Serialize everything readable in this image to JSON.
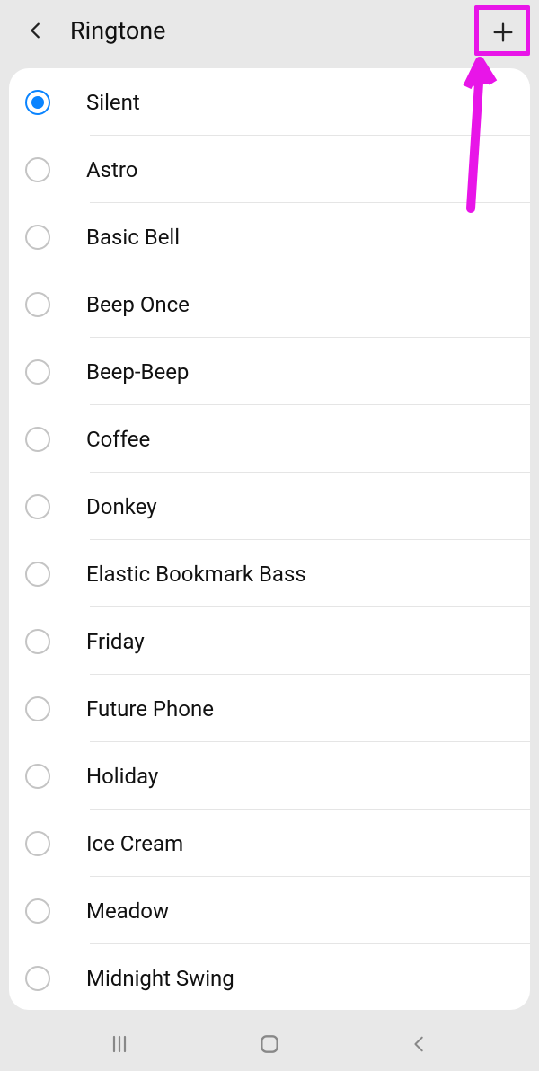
{
  "header": {
    "title": "Ringtone"
  },
  "ringtones": [
    {
      "label": "Silent",
      "selected": true
    },
    {
      "label": "Astro",
      "selected": false
    },
    {
      "label": "Basic Bell",
      "selected": false
    },
    {
      "label": "Beep Once",
      "selected": false
    },
    {
      "label": "Beep-Beep",
      "selected": false
    },
    {
      "label": "Coffee",
      "selected": false
    },
    {
      "label": "Donkey",
      "selected": false
    },
    {
      "label": "Elastic Bookmark Bass",
      "selected": false
    },
    {
      "label": "Friday",
      "selected": false
    },
    {
      "label": "Future Phone",
      "selected": false
    },
    {
      "label": "Holiday",
      "selected": false
    },
    {
      "label": "Ice Cream",
      "selected": false
    },
    {
      "label": "Meadow",
      "selected": false
    },
    {
      "label": "Midnight Swing",
      "selected": false
    }
  ],
  "icons": {
    "back": "chevron-left-icon",
    "add": "plus-icon",
    "recents": "recents-icon",
    "home": "home-icon",
    "navback": "back-icon"
  },
  "annotation": {
    "highlight_color": "#e815e8"
  }
}
